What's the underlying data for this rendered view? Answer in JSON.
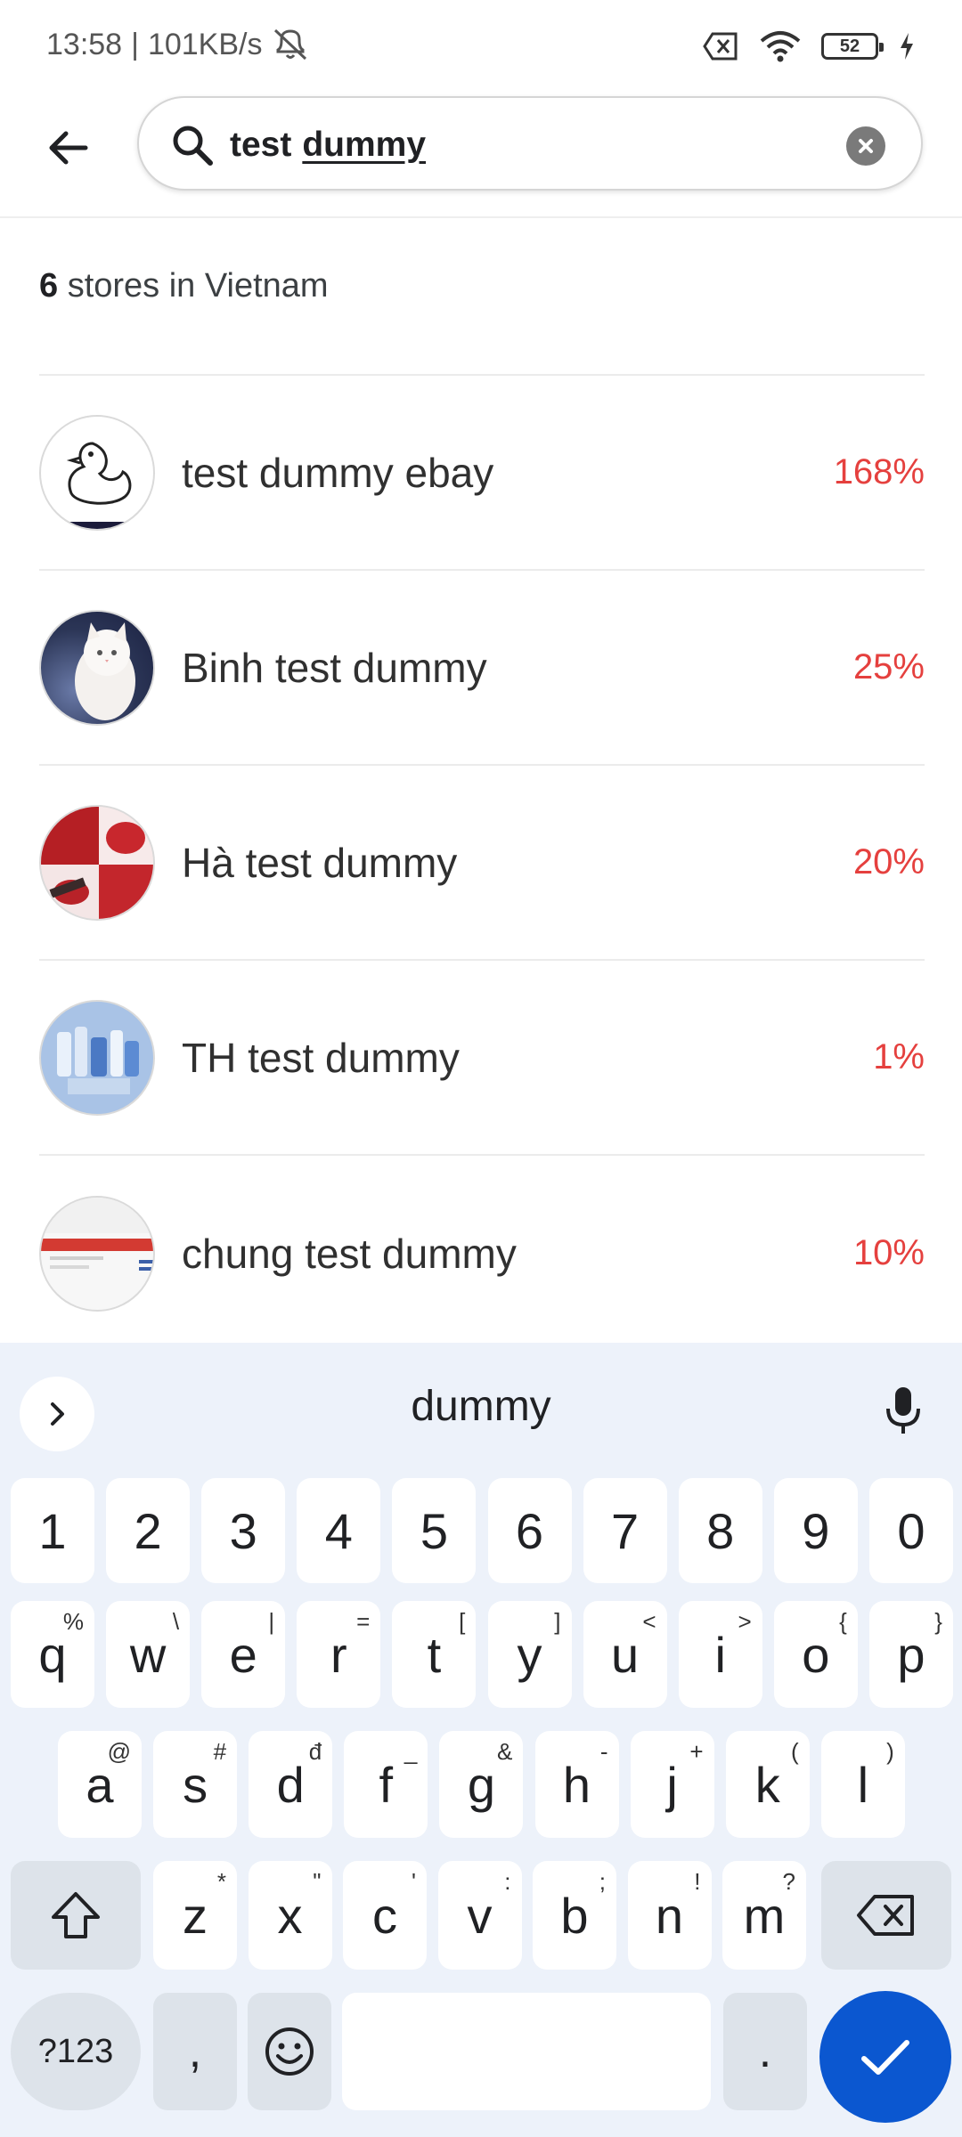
{
  "status": {
    "time": "13:58",
    "network_speed": "101KB/s",
    "battery": "52"
  },
  "search": {
    "query_first": "test",
    "query_second": "dummy"
  },
  "results": {
    "count": "6",
    "summary_text": "stores in Vietnam",
    "stores": [
      {
        "name": "test dummy ebay",
        "percent": "168%"
      },
      {
        "name": "Binh test dummy",
        "percent": "25%"
      },
      {
        "name": "Hà test dummy",
        "percent": "20%"
      },
      {
        "name": "TH test dummy",
        "percent": "1%"
      },
      {
        "name": "chung test dummy",
        "percent": "10%"
      }
    ]
  },
  "keyboard": {
    "suggestion": "dummy",
    "numbers": [
      "1",
      "2",
      "3",
      "4",
      "5",
      "6",
      "7",
      "8",
      "9",
      "0"
    ],
    "row1": [
      [
        "q",
        "%"
      ],
      [
        "w",
        "\\"
      ],
      [
        "e",
        "|"
      ],
      [
        "r",
        "="
      ],
      [
        "t",
        "["
      ],
      [
        "y",
        "]"
      ],
      [
        "u",
        "<"
      ],
      [
        "i",
        ">"
      ],
      [
        "o",
        "{"
      ],
      [
        "p",
        "}"
      ]
    ],
    "row2": [
      [
        "a",
        "@"
      ],
      [
        "s",
        "#"
      ],
      [
        "d",
        "đ"
      ],
      [
        "f",
        "_"
      ],
      [
        "g",
        "&"
      ],
      [
        "h",
        "-"
      ],
      [
        "j",
        "+"
      ],
      [
        "k",
        "("
      ],
      [
        "l",
        ")"
      ]
    ],
    "row3": [
      [
        "z",
        "*"
      ],
      [
        "x",
        "\""
      ],
      [
        "c",
        "'"
      ],
      [
        "v",
        ":"
      ],
      [
        "b",
        ";"
      ],
      [
        "n",
        "!"
      ],
      [
        "m",
        "?"
      ]
    ],
    "symbols_label": "?123",
    "comma_label": ",",
    "period_label": "."
  },
  "colors": {
    "accent_blue": "#0b57d0",
    "percent_red": "#e5403e",
    "keyboard_bg": "#edf2fa"
  }
}
